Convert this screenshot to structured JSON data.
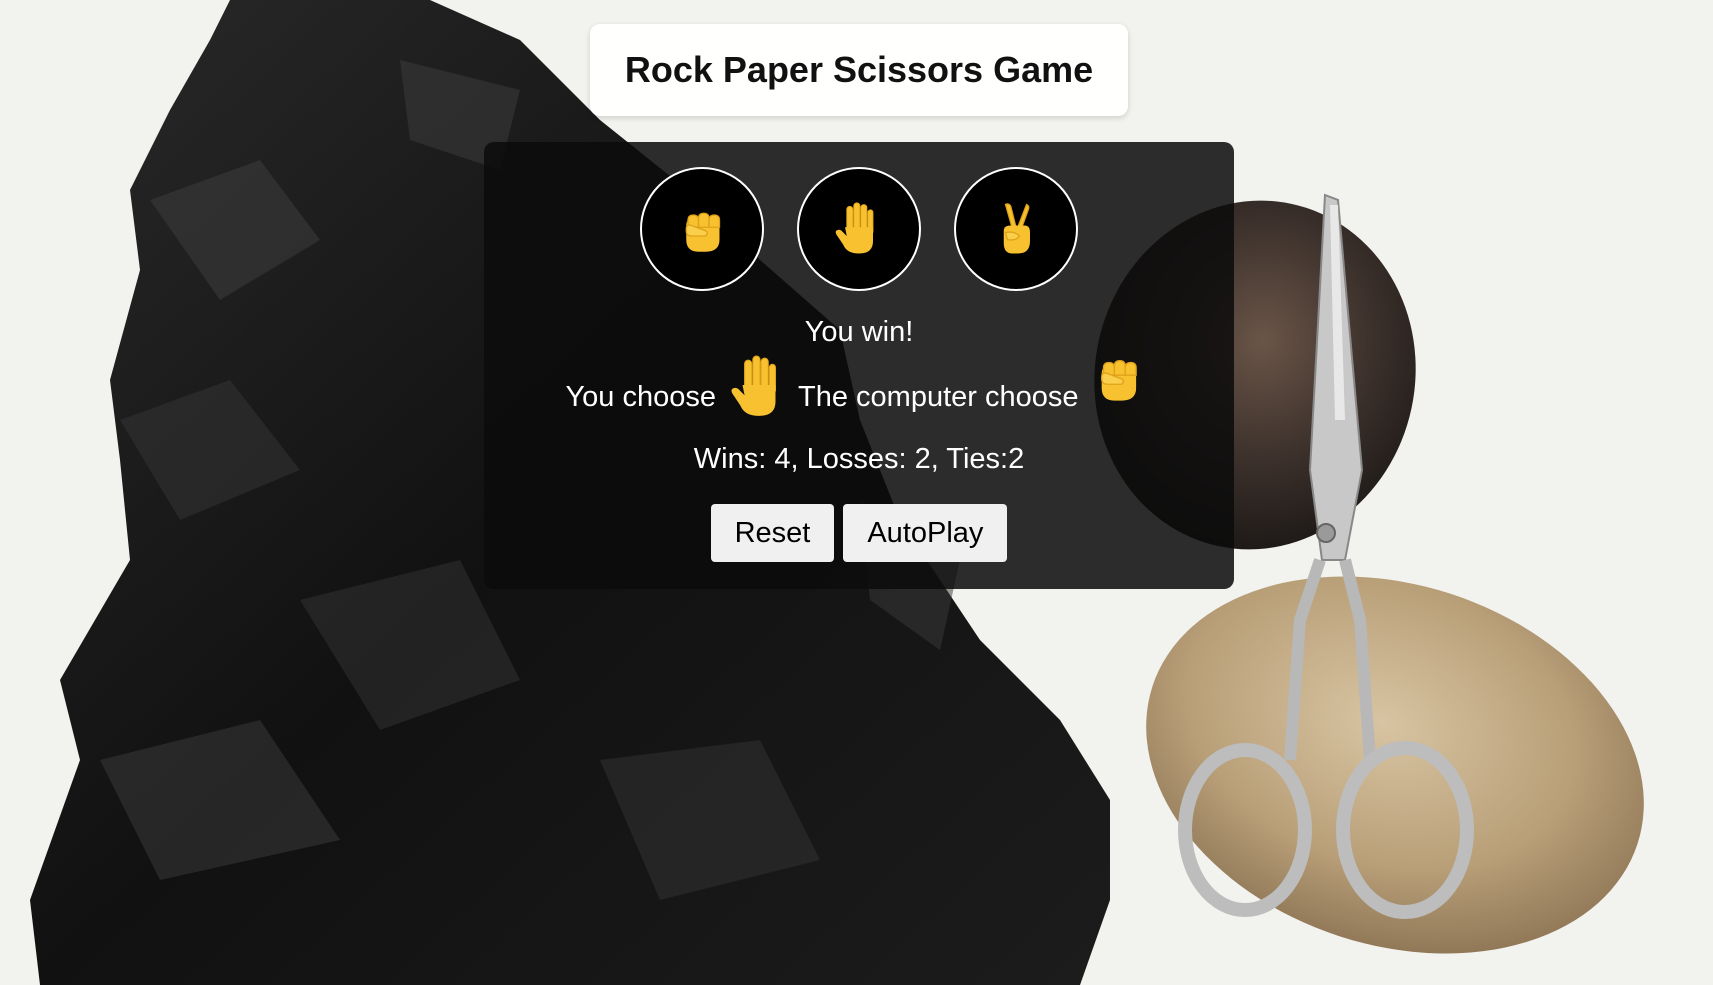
{
  "page": {
    "title": "Rock Paper Scissors Game"
  },
  "moves": [
    {
      "name": "rock",
      "icon": "raised-fist-icon"
    },
    {
      "name": "paper",
      "icon": "raised-hand-icon"
    },
    {
      "name": "scissors",
      "icon": "victory-hand-icon"
    }
  ],
  "result": {
    "text": "You win!",
    "you_label": "You choose",
    "player_move_icon": "raised-hand-icon",
    "computer_label": "The computer choose",
    "computer_move_icon": "raised-fist-icon"
  },
  "score": {
    "text": "Wins: 4, Losses: 2, Ties:2"
  },
  "controls": {
    "reset_label": "Reset",
    "autoplay_label": "AutoPlay"
  },
  "colors": {
    "panel": "#0c0c0c",
    "emoji_yellow": "#f7c12f",
    "emoji_shade": "#e0a21a"
  }
}
